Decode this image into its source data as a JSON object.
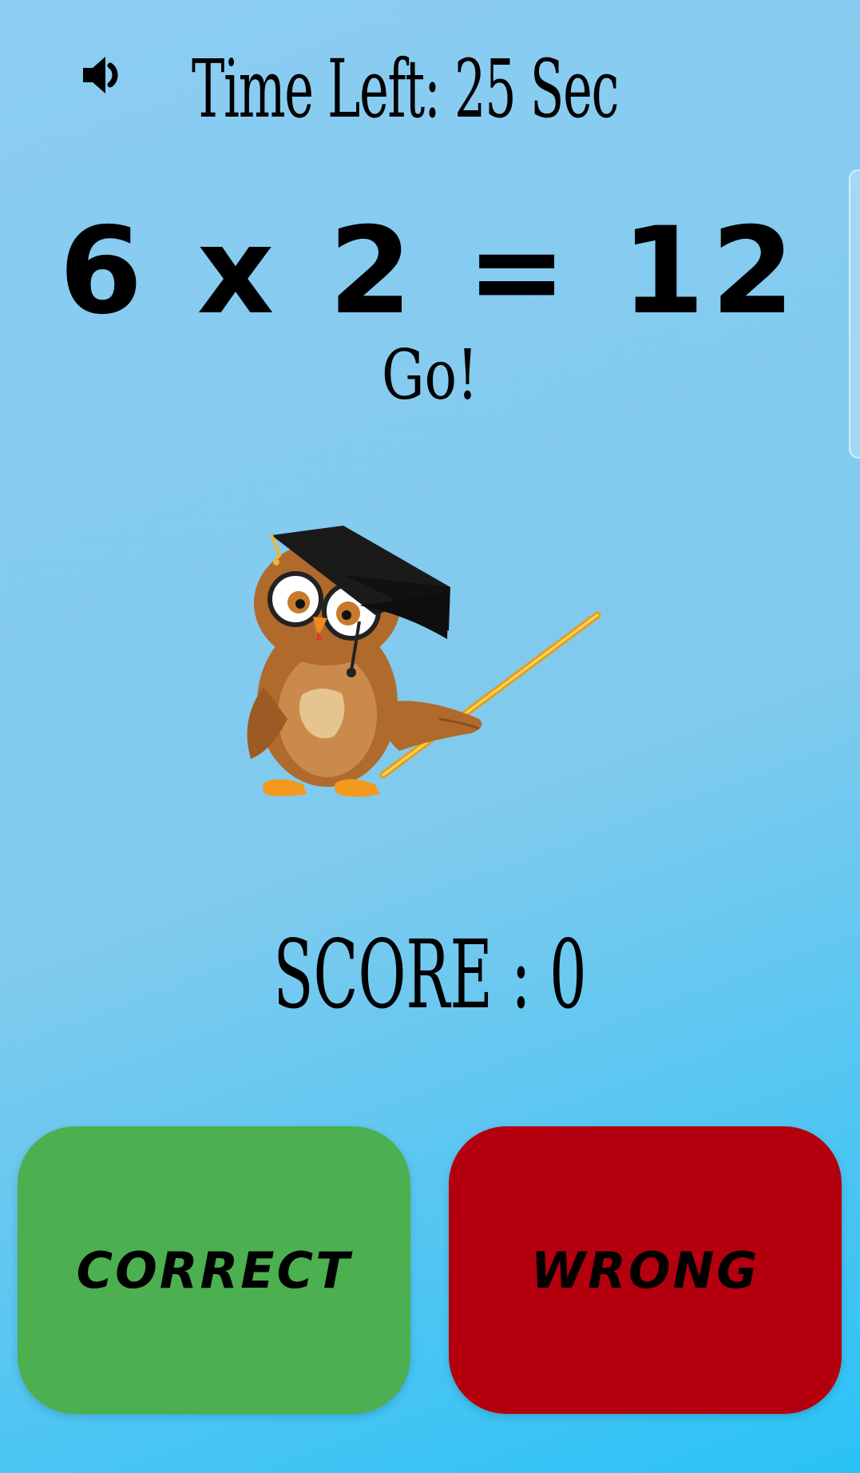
{
  "header": {
    "sound_icon": "speaker-volume-icon",
    "time_left": "Time Left: 25 Sec"
  },
  "question": {
    "equation": "6 x 2 = 12",
    "status": "Go!"
  },
  "mascot": {
    "icon": "owl-teacher-illustration"
  },
  "score": {
    "text": "SCORE : 0"
  },
  "buttons": {
    "correct_label": "CORRECT",
    "wrong_label": "WRONG",
    "correct_color": "#4caf50",
    "wrong_color": "#b4000e"
  }
}
